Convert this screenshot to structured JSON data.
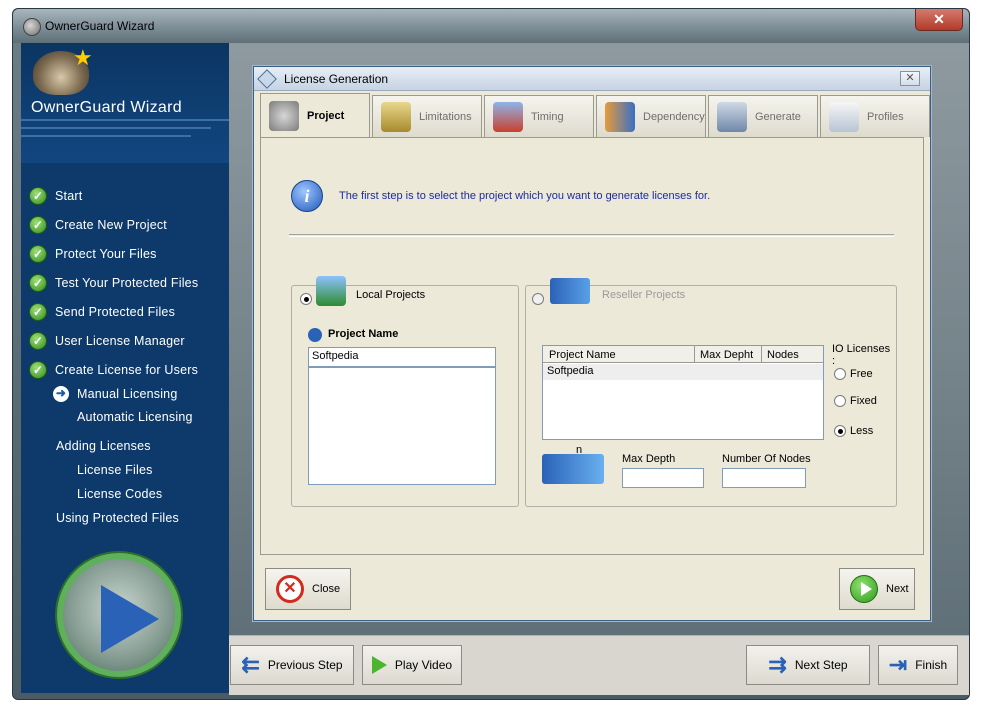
{
  "window": {
    "title": "OwnerGuard Wizard",
    "close_glyph": "✕"
  },
  "sidebar": {
    "title": "OwnerGuard Wizard",
    "items": [
      {
        "label": "Start",
        "icon": "check-icon"
      },
      {
        "label": "Create New Project",
        "icon": "check-icon"
      },
      {
        "label": "Protect Your Files",
        "icon": "check-icon"
      },
      {
        "label": "Test Your Protected Files",
        "icon": "check-icon"
      },
      {
        "label": "Send Protected Files",
        "icon": "check-icon"
      },
      {
        "label": "User License Manager",
        "icon": "check-icon"
      },
      {
        "label": "Create License for Users",
        "icon": "check-icon"
      },
      {
        "label": "Manual Licensing",
        "icon": "arrow-right-icon"
      },
      {
        "label": "Automatic Licensing",
        "icon": ""
      },
      {
        "label": "Adding Licenses",
        "icon": ""
      },
      {
        "label": "License Files",
        "icon": ""
      },
      {
        "label": "License Codes",
        "icon": ""
      },
      {
        "label": "Using Protected Files",
        "icon": ""
      }
    ]
  },
  "dialog": {
    "title": "License Generation",
    "close_glyph": "✕",
    "tabs": [
      {
        "label": "Project",
        "active": true
      },
      {
        "label": "Limitations"
      },
      {
        "label": "Timing"
      },
      {
        "label": "Dependency"
      },
      {
        "label": "Generate"
      },
      {
        "label": "Profiles"
      }
    ],
    "info_text": "The first step is to select the project which you want to generate licenses for.",
    "info_glyph": "i",
    "local": {
      "radio_label": "Local Projects",
      "selected": true,
      "project_name_label": "Project Name",
      "project_name_value": "Softpedia"
    },
    "reseller": {
      "radio_label": "Reseller Projects",
      "selected": false,
      "table_headers": [
        "Project Name",
        "Max Depht",
        "Nodes"
      ],
      "table_rows": [
        [
          "Softpedia",
          "",
          ""
        ]
      ],
      "io_licenses_label": "IO Licenses :",
      "io_options": [
        {
          "label": "Free",
          "selected": false
        },
        {
          "label": "Fixed",
          "selected": false
        },
        {
          "label": "Less",
          "selected": true
        }
      ],
      "tree_n_label": "n",
      "max_depth_label": "Max Depth",
      "max_depth_value": "",
      "number_nodes_label": "Number Of Nodes",
      "number_nodes_value": ""
    },
    "close_button": "Close",
    "close_button_glyph": "✕",
    "next_button": "Next"
  },
  "bottom_bar": {
    "previous_step": "Previous Step",
    "play_video": "Play Video",
    "next_step": "Next Step",
    "finish": "Finish"
  },
  "colors": {
    "sidebar": "#0d3a6a",
    "accent_green": "#4ab52f",
    "accent_blue": "#2a62b8",
    "dialog_bg": "#ece9d8"
  }
}
